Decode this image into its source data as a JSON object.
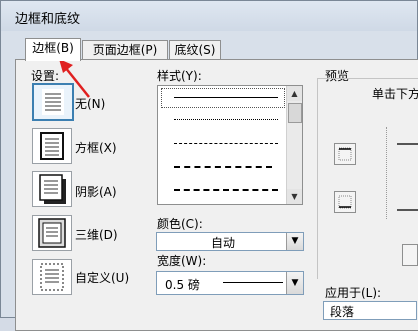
{
  "window": {
    "title": "边框和底纹"
  },
  "tabs": [
    {
      "label": "边框(B)"
    },
    {
      "label": "页面边框(P)"
    },
    {
      "label": "底纹(S)"
    }
  ],
  "settings": {
    "heading": "设置:",
    "items": [
      {
        "label": "无(N)",
        "icon": "border-none-icon"
      },
      {
        "label": "方框(X)",
        "icon": "border-box-icon"
      },
      {
        "label": "阴影(A)",
        "icon": "border-shadow-icon"
      },
      {
        "label": "三维(D)",
        "icon": "border-3d-icon"
      },
      {
        "label": "自定义(U)",
        "icon": "border-custom-icon"
      }
    ]
  },
  "style": {
    "heading": "样式(Y):",
    "options": [
      "solid",
      "dotted",
      "dashed-short",
      "dashed",
      "dash-dot"
    ]
  },
  "color": {
    "label": "颜色(C):",
    "value": "自动"
  },
  "width": {
    "label": "宽度(W):",
    "value": "0.5 磅"
  },
  "preview": {
    "heading": "预览",
    "hint": "单击下方"
  },
  "apply_to": {
    "label": "应用于(L):",
    "value": "段落"
  },
  "annotation": {
    "color": "#e02020"
  }
}
